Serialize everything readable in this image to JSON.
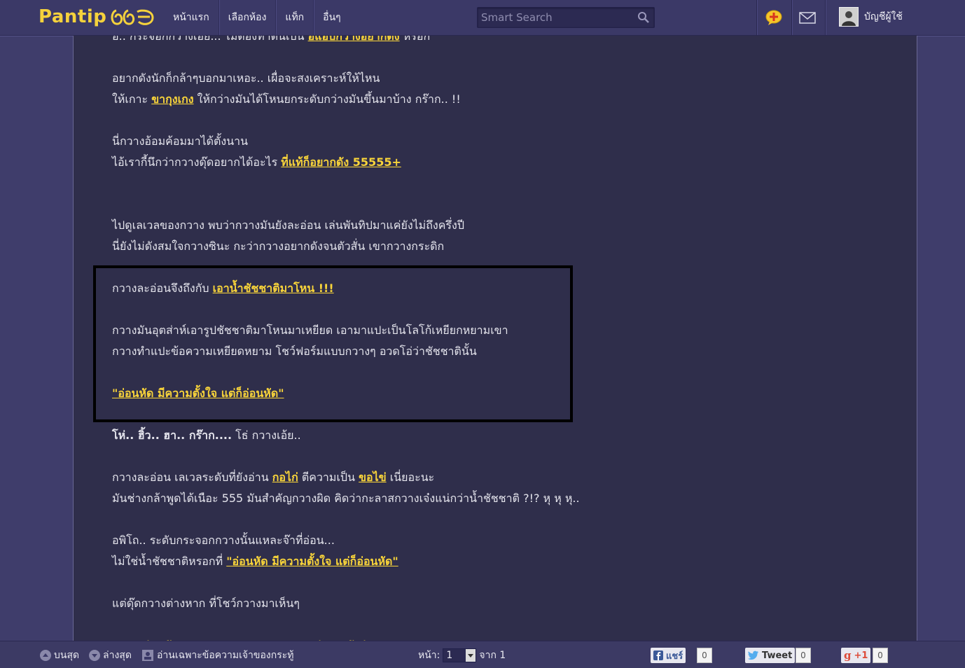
{
  "topbar": {
    "logo_text": "Pantip",
    "nav": [
      "หน้าแรก",
      "เลือกห้อง",
      "แท็ก",
      "อื่นๆ"
    ],
    "search_placeholder": "Smart Search",
    "account_label": "บัญชีผู้ใช้"
  },
  "post": {
    "lines": [
      {
        "text": "อิ.. กระจอกกว่างเอ๋ย... ไม่ต้องทำตนเป็น ",
        "link": "อีแอบกว่างอยากดัง",
        "after": " หรอก"
      },
      {
        "text": ""
      },
      {
        "text": "อยากดังนักก็กล้าๆบอกมาเหอะ.. เผื่อจะสงเคราะห์ให้ไหน"
      },
      {
        "text": "ให้เกาะ ",
        "link": "ขากุงเกง",
        "after": " ให้กว่างมันได้โหนยกระดับกว่างมันขึ้นมาบ้าง กร๊าก.. !!"
      },
      {
        "text": ""
      },
      {
        "text": "นี่กวางอ้อมค้อมมาได้ตั้งนาน"
      },
      {
        "text": "ไอ้เรากี้นึกว่ากวางดุ๊ดอยากได้อะไร ",
        "link": "ที่แท้ก็อยากดัง 55555+"
      },
      {
        "text": ""
      },
      {
        "text": ""
      },
      {
        "text": "ไปดูเลเวลของกวาง พบว่ากวางมันยังละอ่อน เล่นพันทิปมาแค่ยังไม่ถึงครึ่งปี"
      },
      {
        "text": "นี่ยังไม่ดังสมใจกวางซินะ กะว่ากวางอยากดังจนตัวสั่น เขากวางกระดิก"
      },
      {
        "text": ""
      },
      {
        "text": "กวางละอ่อนจึงถึงกับ ",
        "link": "เอาน้ำชัชชาติมาโหน !!!"
      },
      {
        "text": ""
      },
      {
        "text": "กวางมันอุตส่าห์เอารูปชัชชาติมาโหนมาเหยียด เอามาแปะเป็นโลโก้เหยียกหยามเขา"
      },
      {
        "text": "กวางทำแปะข้อความเหยียดหยาม โชว์ฟอร์มแบบกวางๆ อวดโอ่ว่าชัชชาตินั้น"
      },
      {
        "text": ""
      },
      {
        "text": "",
        "link": "\"อ่อนหัด มีความตั้งใจ แต่ก็อ่อนหัด\""
      },
      {
        "text": ""
      },
      {
        "text": "",
        "bold": "โห่.. ฮิ้ว.. ฮา.. กร๊าก....",
        "after": " โธ่ กวางเอ้ย.."
      },
      {
        "text": ""
      },
      {
        "text": "กวางละอ่อน เลเวลระดับที่ยังอ่าน ",
        "link": "กอไก่",
        "after": " ตีความเป็น ",
        "link2": "ขอไข่",
        "after2": " เนี่ยอะนะ"
      },
      {
        "text": "มันช่างกล้าพูดได้เนือะ 555 มันสำคัญกวางผิด คิดว่ากะลาสกวางเจ๋งแน่กว่าน้ำชัชชาติ ?!? หุ หุ หุ.."
      },
      {
        "text": ""
      },
      {
        "text": "อพิโถ.. ระดับกระจอกกวางนั้นแหละจ๊าที่อ่อน..."
      },
      {
        "text": "ไม่ใช่น้ำชัชชาติหรอกที่ ",
        "link": "\"อ่อนหัด มีความตั้งใจ แต่ก็อ่อนหัด\""
      },
      {
        "text": ""
      },
      {
        "text": "แต่ดุ๊ดกวางต่างหาก ที่โชว์กวางมาเห็นๆ"
      },
      {
        "text": ""
      },
      {
        "text": "",
        "fade": "\"กวางอ่อนหัดเองเอออ ความพยายามสูง แต่กะลายังอ่อน"
      }
    ]
  },
  "bottombar": {
    "top_label": "บนสุด",
    "bottom_label": "ล่างสุด",
    "owner_only_label": "อ่านเฉพาะข้อความเจ้าของกระทู้",
    "page_label": "หน้า:",
    "page_value": "1",
    "of_label": "จาก 1",
    "fb_label": "แชร์",
    "fb_count": "0",
    "tweet_label": "Tweet",
    "tweet_count": "0",
    "gplus_label": "+1",
    "gplus_count": "0"
  },
  "colors": {
    "background": "#3f3d6b",
    "content_bg": "#2f2e4b",
    "link": "#f8d43a",
    "logo": "#f5d23c"
  }
}
